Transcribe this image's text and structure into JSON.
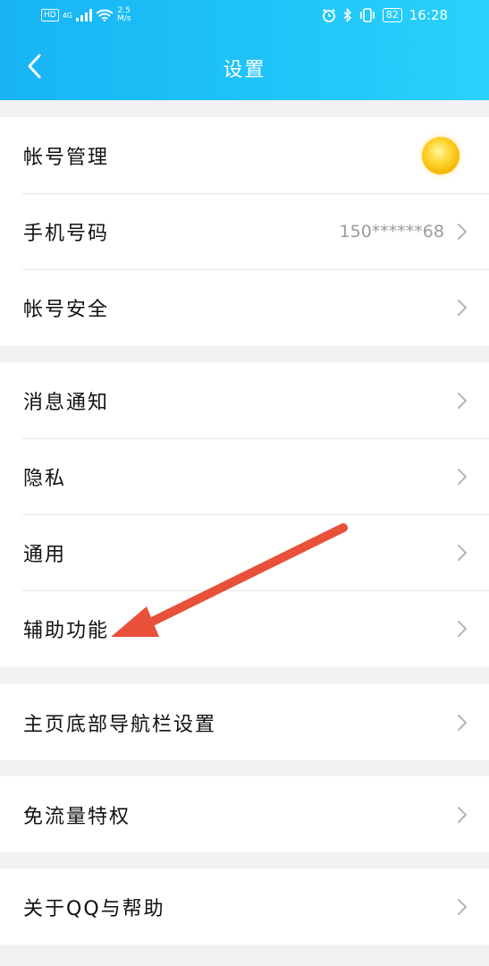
{
  "status_bar": {
    "hd": "HD",
    "network": "4G",
    "speed_value": "2.5",
    "speed_unit": "M/s",
    "battery": "82",
    "time": "16:28"
  },
  "header": {
    "title": "设置",
    "back_icon": "chevron-left-icon"
  },
  "groups": [
    {
      "items": [
        {
          "label": "帐号管理",
          "trailing": "sun-avatar-icon"
        },
        {
          "label": "手机号码",
          "value": "150******68"
        },
        {
          "label": "帐号安全"
        }
      ]
    },
    {
      "items": [
        {
          "label": "消息通知"
        },
        {
          "label": "隐私"
        },
        {
          "label": "通用"
        },
        {
          "label": "辅助功能"
        }
      ]
    },
    {
      "items": [
        {
          "label": "主页底部导航栏设置"
        }
      ]
    },
    {
      "items": [
        {
          "label": "免流量特权"
        }
      ]
    },
    {
      "items": [
        {
          "label": "关于QQ与帮助"
        }
      ]
    }
  ],
  "colors": {
    "header_gradient_start": "#18b4f5",
    "header_gradient_end": "#2ad1fb",
    "annotation_arrow": "#e8503a",
    "background": "#f2f2f4"
  }
}
